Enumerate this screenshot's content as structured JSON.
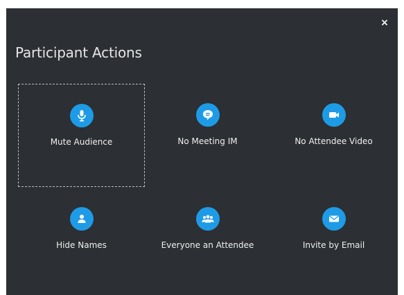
{
  "dialog": {
    "title": "Participant Actions",
    "close_glyph": "×",
    "actions": [
      {
        "label": "Mute Audience",
        "icon": "microphone-icon"
      },
      {
        "label": "No Meeting IM",
        "icon": "chat-bubble-icon"
      },
      {
        "label": "No Attendee Video",
        "icon": "video-camera-icon"
      },
      {
        "label": "Hide Names",
        "icon": "person-icon"
      },
      {
        "label": "Everyone an Attendee",
        "icon": "people-group-icon"
      },
      {
        "label": "Invite by Email",
        "icon": "envelope-icon"
      }
    ]
  },
  "colors": {
    "dialog_background": "#2c2f33",
    "accent": "#1e9be6",
    "text": "#f0f0f0"
  }
}
